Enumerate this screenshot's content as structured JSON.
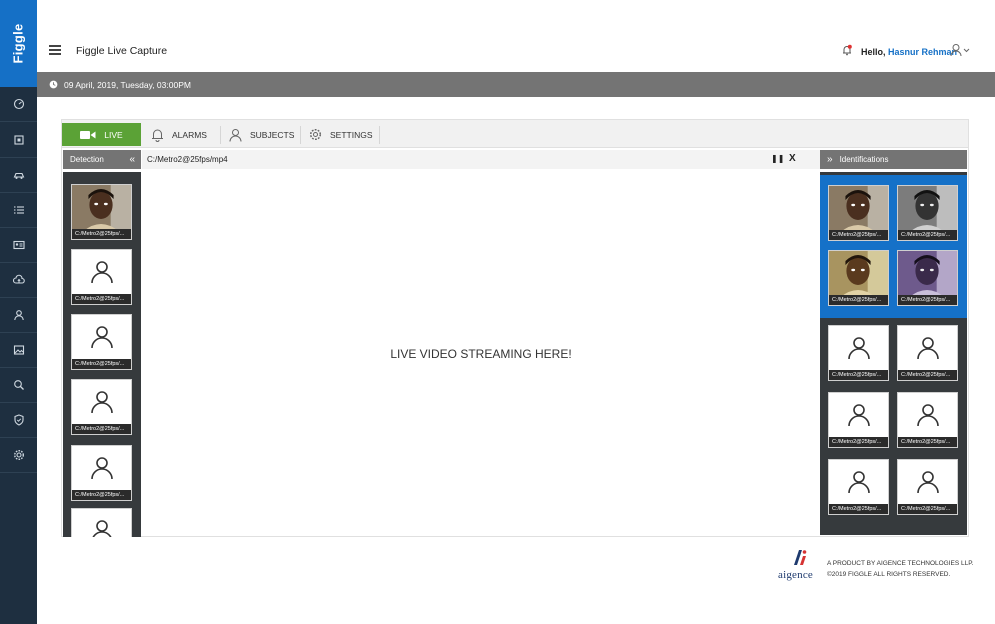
{
  "brand": {
    "name": "Figgle"
  },
  "sidebar": {
    "items": [
      {
        "icon": "dashboard-icon"
      },
      {
        "icon": "scan-icon"
      },
      {
        "icon": "car-icon"
      },
      {
        "icon": "list-icon"
      },
      {
        "icon": "id-card-icon"
      },
      {
        "icon": "cloud-upload-icon"
      },
      {
        "icon": "user-icon"
      },
      {
        "icon": "gallery-icon"
      },
      {
        "icon": "search-icon"
      },
      {
        "icon": "shield-icon"
      },
      {
        "icon": "gear-icon"
      }
    ]
  },
  "header": {
    "title": "Figgle Live Capture",
    "greeting": "Hello,",
    "username": "Hasnur Rehman"
  },
  "datebar": {
    "text": "09 April, 2019, Tuesday, 03:00PM"
  },
  "tabs": [
    {
      "label": "LIVE",
      "icon": "video-camera-icon",
      "active": true
    },
    {
      "label": "ALARMS",
      "icon": "bell-icon",
      "active": false
    },
    {
      "label": "SUBJECTS",
      "icon": "user-icon",
      "active": false
    },
    {
      "label": "SETTINGS",
      "icon": "gear-icon",
      "active": false
    }
  ],
  "detection": {
    "label": "Detection",
    "collapse_glyph": "«",
    "items": [
      {
        "caption": "C:/Metro2@25fps/...",
        "type": "face"
      },
      {
        "caption": "C:/Metro2@25fps/...",
        "type": "placeholder"
      },
      {
        "caption": "C:/Metro2@25fps/...",
        "type": "placeholder"
      },
      {
        "caption": "C:/Metro2@25fps/...",
        "type": "placeholder"
      },
      {
        "caption": "C:/Metro2@25fps/...",
        "type": "placeholder"
      },
      {
        "caption": "",
        "type": "placeholder"
      }
    ]
  },
  "stream": {
    "path": "C:/Metro2@25fps/mp4",
    "pause_glyph": "❚❚",
    "close_glyph": "X",
    "message": "LIVE VIDEO STREAMING HERE!"
  },
  "identifications": {
    "label": "Identifications",
    "expand_glyph": "»",
    "matches": [
      {
        "caption": "C:/Metro2@25fps/...",
        "tint": "color"
      },
      {
        "caption": "C:/Metro2@25fps/...",
        "tint": "gray"
      },
      {
        "caption": "C:/Metro2@25fps/...",
        "tint": "warm"
      },
      {
        "caption": "C:/Metro2@25fps/...",
        "tint": "purple"
      }
    ],
    "others": [
      {
        "caption": "C:/Metro2@25fps/..."
      },
      {
        "caption": "C:/Metro2@25fps/..."
      },
      {
        "caption": "C:/Metro2@25fps/..."
      },
      {
        "caption": "C:/Metro2@25fps/..."
      },
      {
        "caption": "C:/Metro2@25fps/..."
      },
      {
        "caption": "C:/Metro2@25fps/..."
      }
    ]
  },
  "footer": {
    "logo_text": "aigence",
    "line1": "A PRODUCT BY AIGENCE TECHNOLOGIES LLP.",
    "line2": "©2019 FIGGLE  ALL RIGHTS RESERVED."
  },
  "colors": {
    "sidebar": "#1e2f40",
    "brand": "#1570c6",
    "live_tab": "#5ba236",
    "datebar": "#747474",
    "identification_highlight": "#1571c8"
  }
}
